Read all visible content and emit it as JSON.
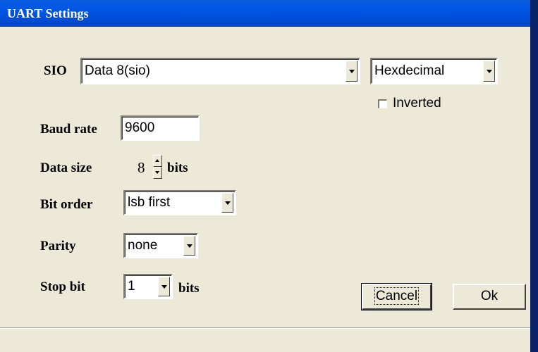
{
  "window": {
    "title": "UART Settings"
  },
  "sio": {
    "label": "SIO",
    "selected": "Data 8(sio)",
    "format_selected": "Hexdecimal",
    "inverted_label": "Inverted",
    "inverted_checked": false
  },
  "baud": {
    "label": "Baud rate",
    "value": "9600"
  },
  "data_size": {
    "label": "Data size",
    "value": "8",
    "unit": "bits"
  },
  "bit_order": {
    "label": "Bit order",
    "selected": "lsb first"
  },
  "parity": {
    "label": "Parity",
    "selected": "none"
  },
  "stop_bit": {
    "label": "Stop bit",
    "selected": "1",
    "unit": "bits"
  },
  "buttons": {
    "cancel": "Cancel",
    "ok": "Ok"
  }
}
